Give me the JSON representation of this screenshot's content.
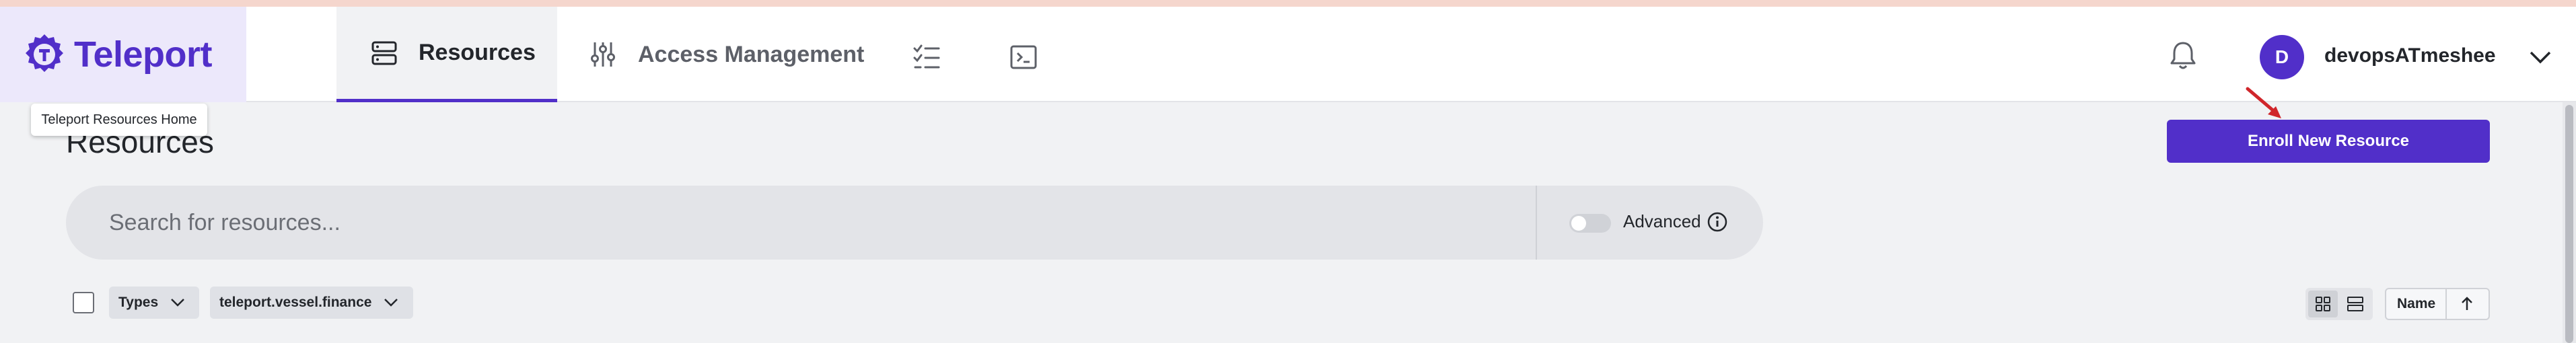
{
  "brand": {
    "name": "Teleport",
    "color": "#512fc9"
  },
  "nav": {
    "tabs": [
      {
        "label": "Resources",
        "icon": "server-stack-icon",
        "active": true
      },
      {
        "label": "Access Management",
        "icon": "sliders-icon",
        "active": false
      }
    ],
    "extra_icons": [
      "checklist-icon",
      "terminal-icon"
    ],
    "notifications_icon": "bell-icon",
    "user": {
      "initial": "D",
      "name": "devopsATmeshee"
    }
  },
  "tooltip": "Teleport Resources Home",
  "page": {
    "title": "Resources",
    "enroll_label": "Enroll New Resource"
  },
  "search": {
    "placeholder": "Search for resources...",
    "advanced_label": "Advanced",
    "advanced_enabled": false
  },
  "filters": {
    "types_label": "Types",
    "cluster_label": "teleport.vessel.finance"
  },
  "sort": {
    "label": "Name",
    "direction": "ascending"
  },
  "colors": {
    "accent": "#512fc9",
    "annotation_arrow": "#d0262b"
  }
}
